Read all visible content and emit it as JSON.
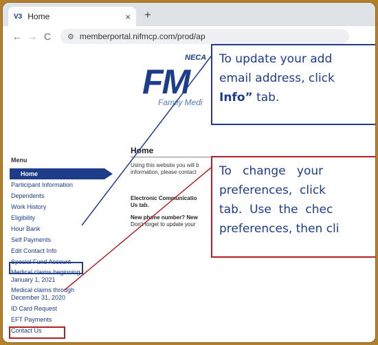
{
  "browser": {
    "tab": {
      "favicon": "V3",
      "title": "Home",
      "close": "×"
    },
    "new_tab": "+",
    "nav": {
      "back": "←",
      "forward": "→",
      "reload": "C"
    },
    "url": "memberportal.nifmcp.com/prod/ap"
  },
  "logo": {
    "neca": "NECA",
    "main": "FM",
    "sub": "Family Medi"
  },
  "menu": {
    "heading": "Menu",
    "items": [
      {
        "label": "Home",
        "active": true
      },
      {
        "label": "Participant Information"
      },
      {
        "label": "Dependents"
      },
      {
        "label": "Work History"
      },
      {
        "label": "Eligibility"
      },
      {
        "label": "Hour Bank"
      },
      {
        "label": "Self Payments"
      },
      {
        "label": "Edit Contact Info"
      },
      {
        "label": "Special Fund Account"
      },
      {
        "label": "Medical claims beginning",
        "label2": "January 1, 2021"
      },
      {
        "label": "Medical claims through",
        "label2": "December 31, 2020"
      },
      {
        "label": "ID Card Request"
      },
      {
        "label": "EFT Payments"
      },
      {
        "label": "Contact Us"
      }
    ]
  },
  "content": {
    "title": "Home",
    "intro_1": "Using this website you will b",
    "intro_2": "information, please contact",
    "ecomm_1": "Electronic Communicatio",
    "ecomm_2": "Us tab.",
    "phone_1": "New phone number? New",
    "phone_2": "Don't forget to update your"
  },
  "callouts": {
    "edit": {
      "line1": "To update your add",
      "line2": "email address, click",
      "line3_bold": "Info”",
      "line3_rest": " tab."
    },
    "contact": {
      "line1": "To   change   your",
      "line2": "preferences,  click",
      "line3": "tab.  Use  the  chec",
      "line4": "preferences, then cli"
    }
  },
  "colors": {
    "frame": "#b37f2a",
    "brand_blue": "#1d3c8a",
    "callout_red": "#b02024"
  }
}
